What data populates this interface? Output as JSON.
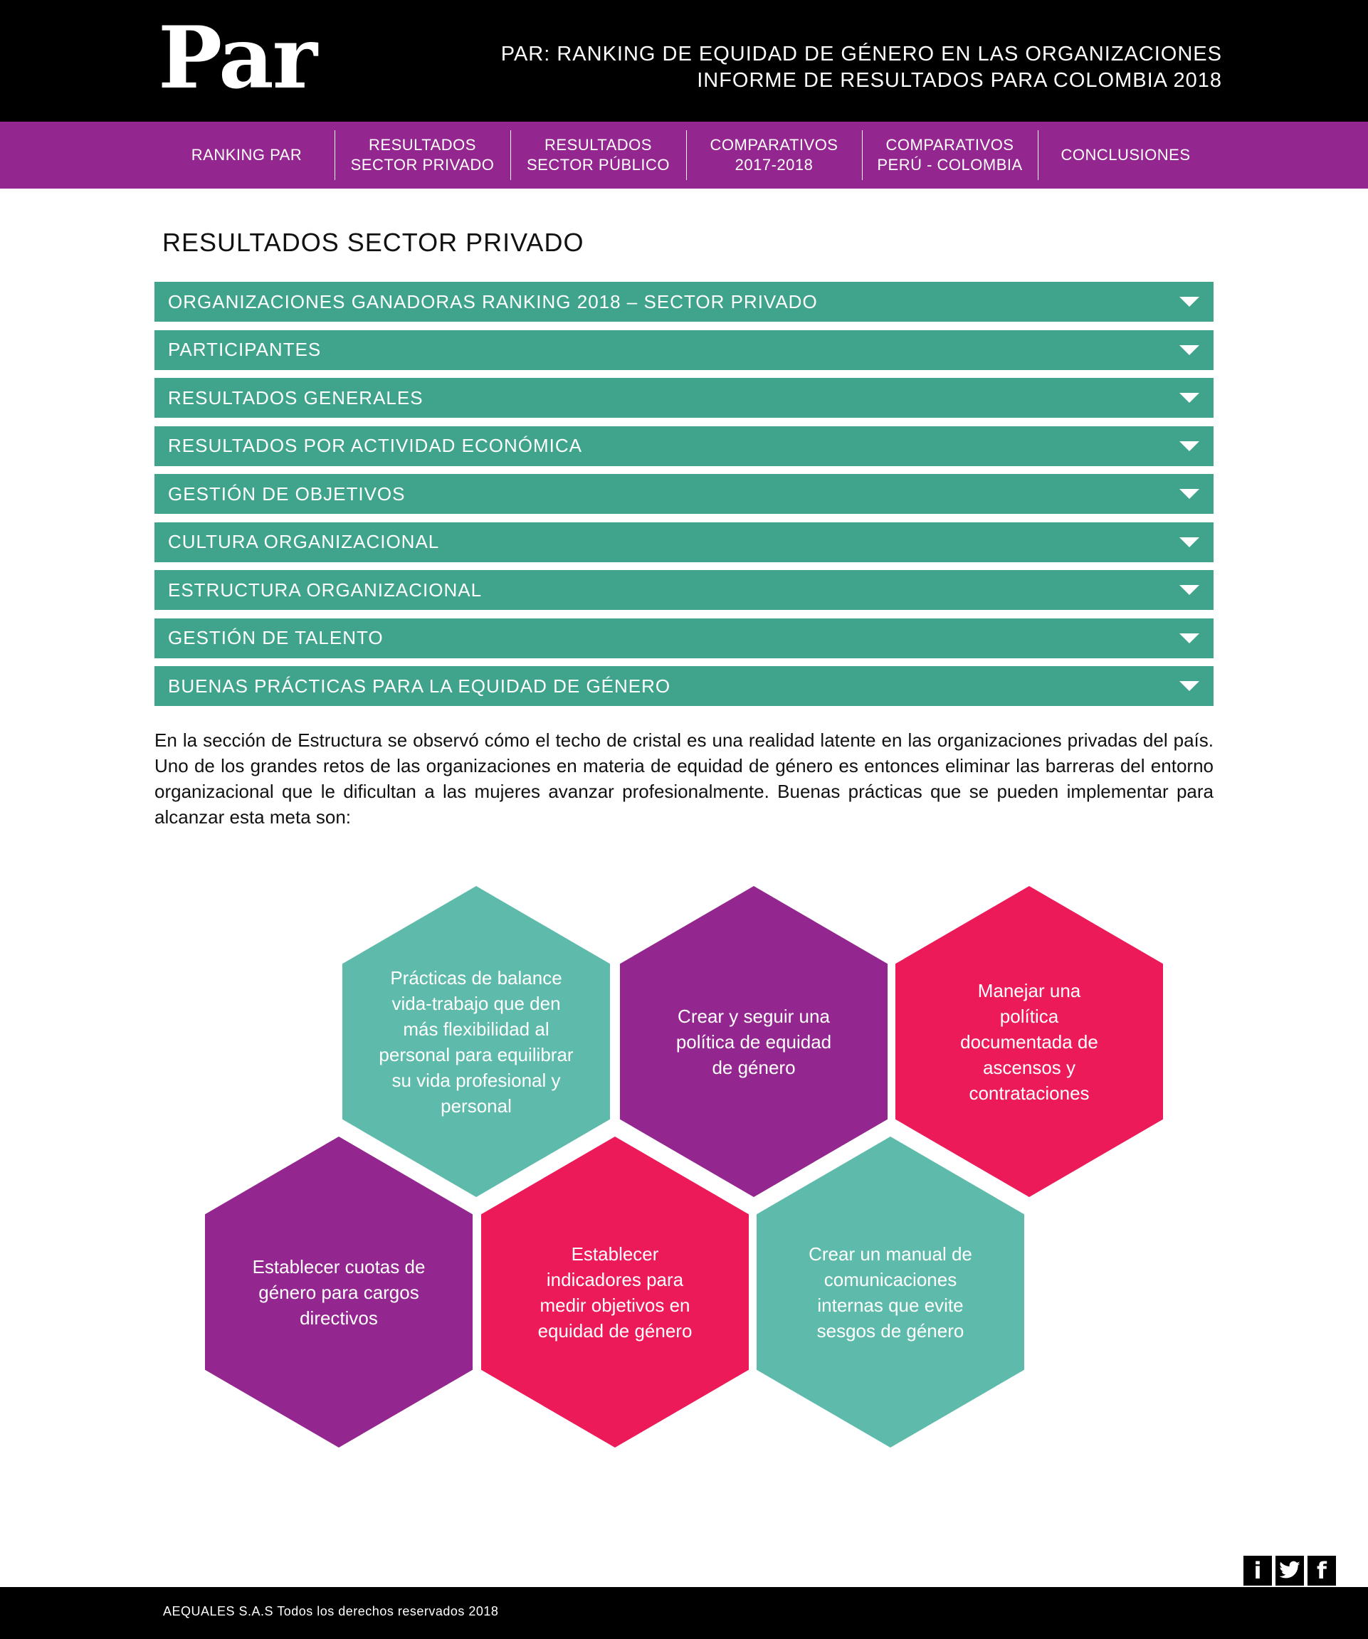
{
  "header": {
    "logo": "Par",
    "title_line1": "PAR: RANKING DE EQUIDAD DE GÉNERO EN LAS ORGANIZACIONES",
    "title_line2": "INFORME DE RESULTADOS PARA COLOMBIA 2018"
  },
  "nav": {
    "items": [
      {
        "line1": "RANKING PAR",
        "line2": ""
      },
      {
        "line1": "RESULTADOS",
        "line2": "SECTOR PRIVADO"
      },
      {
        "line1": "RESULTADOS",
        "line2": "SECTOR PÚBLICO"
      },
      {
        "line1": "COMPARATIVOS",
        "line2": "2017-2018"
      },
      {
        "line1": "COMPARATIVOS",
        "line2": "PERÚ - COLOMBIA"
      },
      {
        "line1": "CONCLUSIONES",
        "line2": ""
      }
    ]
  },
  "section": {
    "title": "RESULTADOS SECTOR PRIVADO"
  },
  "accordion": [
    "ORGANIZACIONES GANADORAS RANKING 2018 – SECTOR PRIVADO",
    "PARTICIPANTES",
    "RESULTADOS GENERALES",
    "RESULTADOS POR ACTIVIDAD ECONÓMICA",
    "GESTIÓN DE OBJETIVOS",
    "CULTURA ORGANIZACIONAL",
    "ESTRUCTURA ORGANIZACIONAL",
    "GESTIÓN DE TALENTO",
    "BUENAS PRÁCTICAS PARA LA EQUIDAD DE GÉNERO"
  ],
  "intro": "En la sección de Estructura se observó cómo el techo de cristal es una realidad latente en las organizaciones privadas del país. Uno de los grandes retos de las organizaciones en materia de equidad de género es entonces eliminar las barreras del entorno organizacional que le dificultan a las mujeres avanzar profesionalmente. Buenas prácticas que se pueden implementar para alcanzar esta meta son:",
  "practices": [
    {
      "text": "Prácticas de balance vida-trabajo que den más flexibilidad al personal para equilibrar su vida profesional y personal",
      "color": "#5ebaaa"
    },
    {
      "text": "Crear y seguir una política de equidad de género",
      "color": "#93278f"
    },
    {
      "text": "Manejar una política documentada de ascensos y contrataciones",
      "color": "#ed1a5a"
    },
    {
      "text": "Establecer cuotas de género para cargos directivos",
      "color": "#93278f"
    },
    {
      "text": "Establecer indicadores para medir objetivos en equidad de género",
      "color": "#ed1a5a"
    },
    {
      "text": "Crear un manual de comunicaciones internas que evite sesgos de género",
      "color": "#5ebaaa"
    }
  ],
  "social": {
    "icons": [
      "instagram-icon",
      "twitter-icon",
      "facebook-icon"
    ],
    "info_glyph": "i",
    "facebook_glyph": "f"
  },
  "footer": {
    "text": "AEQUALES  S.A.S Todos los derechos reservados 2018"
  },
  "colors": {
    "header_bg": "#000000",
    "nav_bg": "#93278f",
    "accordion_bg": "#40a48d",
    "teal": "#5ebaaa",
    "purple": "#93278f",
    "pink": "#ed1a5a"
  }
}
